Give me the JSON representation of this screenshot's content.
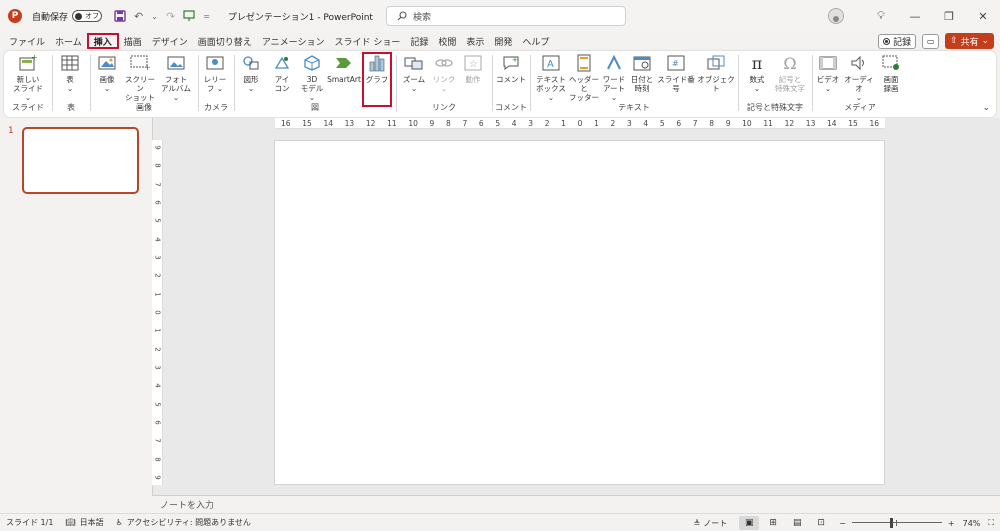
{
  "titlebar": {
    "app_logo": "P",
    "autosave_label": "自動保存",
    "autosave_state": "オフ",
    "doc_title": "プレゼンテーション1  -  PowerPoint",
    "search_placeholder": "検索"
  },
  "menu": {
    "tabs": [
      "ファイル",
      "ホーム",
      "挿入",
      "描画",
      "デザイン",
      "画面切り替え",
      "アニメーション",
      "スライド ショー",
      "記録",
      "校閲",
      "表示",
      "開発",
      "ヘルプ"
    ],
    "active_index": 2,
    "record_label": "記録",
    "share_label": "共有"
  },
  "ribbon": {
    "groups": {
      "slides": "スライド",
      "tables": "表",
      "images": "画像",
      "camera": "カメラ",
      "illustrations": "図",
      "links": "リンク",
      "comments": "コメント",
      "text": "テキスト",
      "symbols": "記号と特殊文字",
      "media": "メディア"
    },
    "buttons": {
      "new_slide": [
        "新しい",
        "スライド ⌄"
      ],
      "table": [
        "表",
        "⌄"
      ],
      "picture": [
        "画像",
        "⌄"
      ],
      "screenshot": [
        "スクリーン",
        "ショット ⌄"
      ],
      "photo_album": [
        "フォト",
        "アルバム ⌄"
      ],
      "cameo": [
        "レリー",
        "フ ⌄"
      ],
      "shapes": [
        "図形",
        "⌄"
      ],
      "icons": [
        "アイ",
        "コン"
      ],
      "model3d": [
        "3D",
        "モデル ⌄"
      ],
      "smartart": [
        "SmartArt"
      ],
      "chart": [
        "グラフ"
      ],
      "zoom": [
        "ズーム",
        "⌄"
      ],
      "link": [
        "リンク",
        "⌄"
      ],
      "action": [
        "動作"
      ],
      "comment": [
        "コメント"
      ],
      "textbox": [
        "テキスト",
        "ボックス ⌄"
      ],
      "header_footer": [
        "ヘッダーと",
        "フッター"
      ],
      "wordart": [
        "ワード",
        "アート ⌄"
      ],
      "datetime": [
        "日付と",
        "時刻"
      ],
      "slide_number": [
        "スライド番号"
      ],
      "object": [
        "オブジェクト"
      ],
      "equation": [
        "数式",
        "⌄"
      ],
      "symbol": [
        "記号と",
        "特殊文字"
      ],
      "video": [
        "ビデオ",
        "⌄"
      ],
      "audio": [
        "オーディオ",
        "⌄"
      ],
      "screen_recording": [
        "画面",
        "録画"
      ]
    }
  },
  "thumbs": {
    "slide_number": "1"
  },
  "ruler": {
    "h": [
      "16",
      "15",
      "14",
      "13",
      "12",
      "11",
      "10",
      "9",
      "8",
      "7",
      "6",
      "5",
      "4",
      "3",
      "2",
      "1",
      "0",
      "1",
      "2",
      "3",
      "4",
      "5",
      "6",
      "7",
      "8",
      "9",
      "10",
      "11",
      "12",
      "13",
      "14",
      "15",
      "16"
    ],
    "v": [
      "9",
      "8",
      "7",
      "6",
      "5",
      "4",
      "3",
      "2",
      "1",
      "0",
      "1",
      "2",
      "3",
      "4",
      "5",
      "6",
      "7",
      "8",
      "9"
    ]
  },
  "notes_placeholder": "ノートを入力",
  "status": {
    "slide": "スライド 1/1",
    "language": "日本語",
    "accessibility": "アクセシビリティ: 問題ありません",
    "notes": "ノート",
    "zoom": "74%"
  },
  "colors": {
    "accent": "#c43e1c",
    "highlight": "#c8102e"
  }
}
